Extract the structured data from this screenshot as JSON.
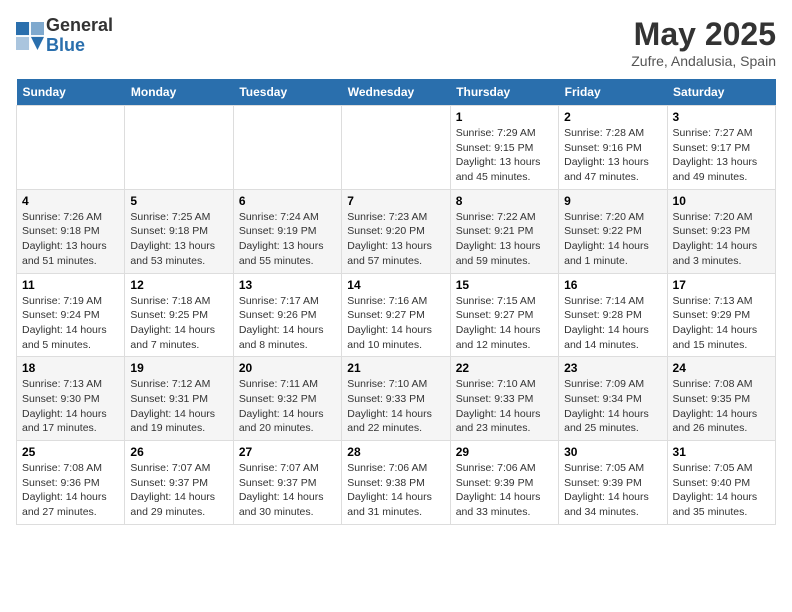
{
  "header": {
    "logo_general": "General",
    "logo_blue": "Blue",
    "month_title": "May 2025",
    "subtitle": "Zufre, Andalusia, Spain"
  },
  "days_of_week": [
    "Sunday",
    "Monday",
    "Tuesday",
    "Wednesday",
    "Thursday",
    "Friday",
    "Saturday"
  ],
  "weeks": [
    [
      {
        "day": "",
        "info": ""
      },
      {
        "day": "",
        "info": ""
      },
      {
        "day": "",
        "info": ""
      },
      {
        "day": "",
        "info": ""
      },
      {
        "day": "1",
        "info": "Sunrise: 7:29 AM\nSunset: 9:15 PM\nDaylight: 13 hours and 45 minutes."
      },
      {
        "day": "2",
        "info": "Sunrise: 7:28 AM\nSunset: 9:16 PM\nDaylight: 13 hours and 47 minutes."
      },
      {
        "day": "3",
        "info": "Sunrise: 7:27 AM\nSunset: 9:17 PM\nDaylight: 13 hours and 49 minutes."
      }
    ],
    [
      {
        "day": "4",
        "info": "Sunrise: 7:26 AM\nSunset: 9:18 PM\nDaylight: 13 hours and 51 minutes."
      },
      {
        "day": "5",
        "info": "Sunrise: 7:25 AM\nSunset: 9:18 PM\nDaylight: 13 hours and 53 minutes."
      },
      {
        "day": "6",
        "info": "Sunrise: 7:24 AM\nSunset: 9:19 PM\nDaylight: 13 hours and 55 minutes."
      },
      {
        "day": "7",
        "info": "Sunrise: 7:23 AM\nSunset: 9:20 PM\nDaylight: 13 hours and 57 minutes."
      },
      {
        "day": "8",
        "info": "Sunrise: 7:22 AM\nSunset: 9:21 PM\nDaylight: 13 hours and 59 minutes."
      },
      {
        "day": "9",
        "info": "Sunrise: 7:20 AM\nSunset: 9:22 PM\nDaylight: 14 hours and 1 minute."
      },
      {
        "day": "10",
        "info": "Sunrise: 7:20 AM\nSunset: 9:23 PM\nDaylight: 14 hours and 3 minutes."
      }
    ],
    [
      {
        "day": "11",
        "info": "Sunrise: 7:19 AM\nSunset: 9:24 PM\nDaylight: 14 hours and 5 minutes."
      },
      {
        "day": "12",
        "info": "Sunrise: 7:18 AM\nSunset: 9:25 PM\nDaylight: 14 hours and 7 minutes."
      },
      {
        "day": "13",
        "info": "Sunrise: 7:17 AM\nSunset: 9:26 PM\nDaylight: 14 hours and 8 minutes."
      },
      {
        "day": "14",
        "info": "Sunrise: 7:16 AM\nSunset: 9:27 PM\nDaylight: 14 hours and 10 minutes."
      },
      {
        "day": "15",
        "info": "Sunrise: 7:15 AM\nSunset: 9:27 PM\nDaylight: 14 hours and 12 minutes."
      },
      {
        "day": "16",
        "info": "Sunrise: 7:14 AM\nSunset: 9:28 PM\nDaylight: 14 hours and 14 minutes."
      },
      {
        "day": "17",
        "info": "Sunrise: 7:13 AM\nSunset: 9:29 PM\nDaylight: 14 hours and 15 minutes."
      }
    ],
    [
      {
        "day": "18",
        "info": "Sunrise: 7:13 AM\nSunset: 9:30 PM\nDaylight: 14 hours and 17 minutes."
      },
      {
        "day": "19",
        "info": "Sunrise: 7:12 AM\nSunset: 9:31 PM\nDaylight: 14 hours and 19 minutes."
      },
      {
        "day": "20",
        "info": "Sunrise: 7:11 AM\nSunset: 9:32 PM\nDaylight: 14 hours and 20 minutes."
      },
      {
        "day": "21",
        "info": "Sunrise: 7:10 AM\nSunset: 9:33 PM\nDaylight: 14 hours and 22 minutes."
      },
      {
        "day": "22",
        "info": "Sunrise: 7:10 AM\nSunset: 9:33 PM\nDaylight: 14 hours and 23 minutes."
      },
      {
        "day": "23",
        "info": "Sunrise: 7:09 AM\nSunset: 9:34 PM\nDaylight: 14 hours and 25 minutes."
      },
      {
        "day": "24",
        "info": "Sunrise: 7:08 AM\nSunset: 9:35 PM\nDaylight: 14 hours and 26 minutes."
      }
    ],
    [
      {
        "day": "25",
        "info": "Sunrise: 7:08 AM\nSunset: 9:36 PM\nDaylight: 14 hours and 27 minutes."
      },
      {
        "day": "26",
        "info": "Sunrise: 7:07 AM\nSunset: 9:37 PM\nDaylight: 14 hours and 29 minutes."
      },
      {
        "day": "27",
        "info": "Sunrise: 7:07 AM\nSunset: 9:37 PM\nDaylight: 14 hours and 30 minutes."
      },
      {
        "day": "28",
        "info": "Sunrise: 7:06 AM\nSunset: 9:38 PM\nDaylight: 14 hours and 31 minutes."
      },
      {
        "day": "29",
        "info": "Sunrise: 7:06 AM\nSunset: 9:39 PM\nDaylight: 14 hours and 33 minutes."
      },
      {
        "day": "30",
        "info": "Sunrise: 7:05 AM\nSunset: 9:39 PM\nDaylight: 14 hours and 34 minutes."
      },
      {
        "day": "31",
        "info": "Sunrise: 7:05 AM\nSunset: 9:40 PM\nDaylight: 14 hours and 35 minutes."
      }
    ]
  ]
}
